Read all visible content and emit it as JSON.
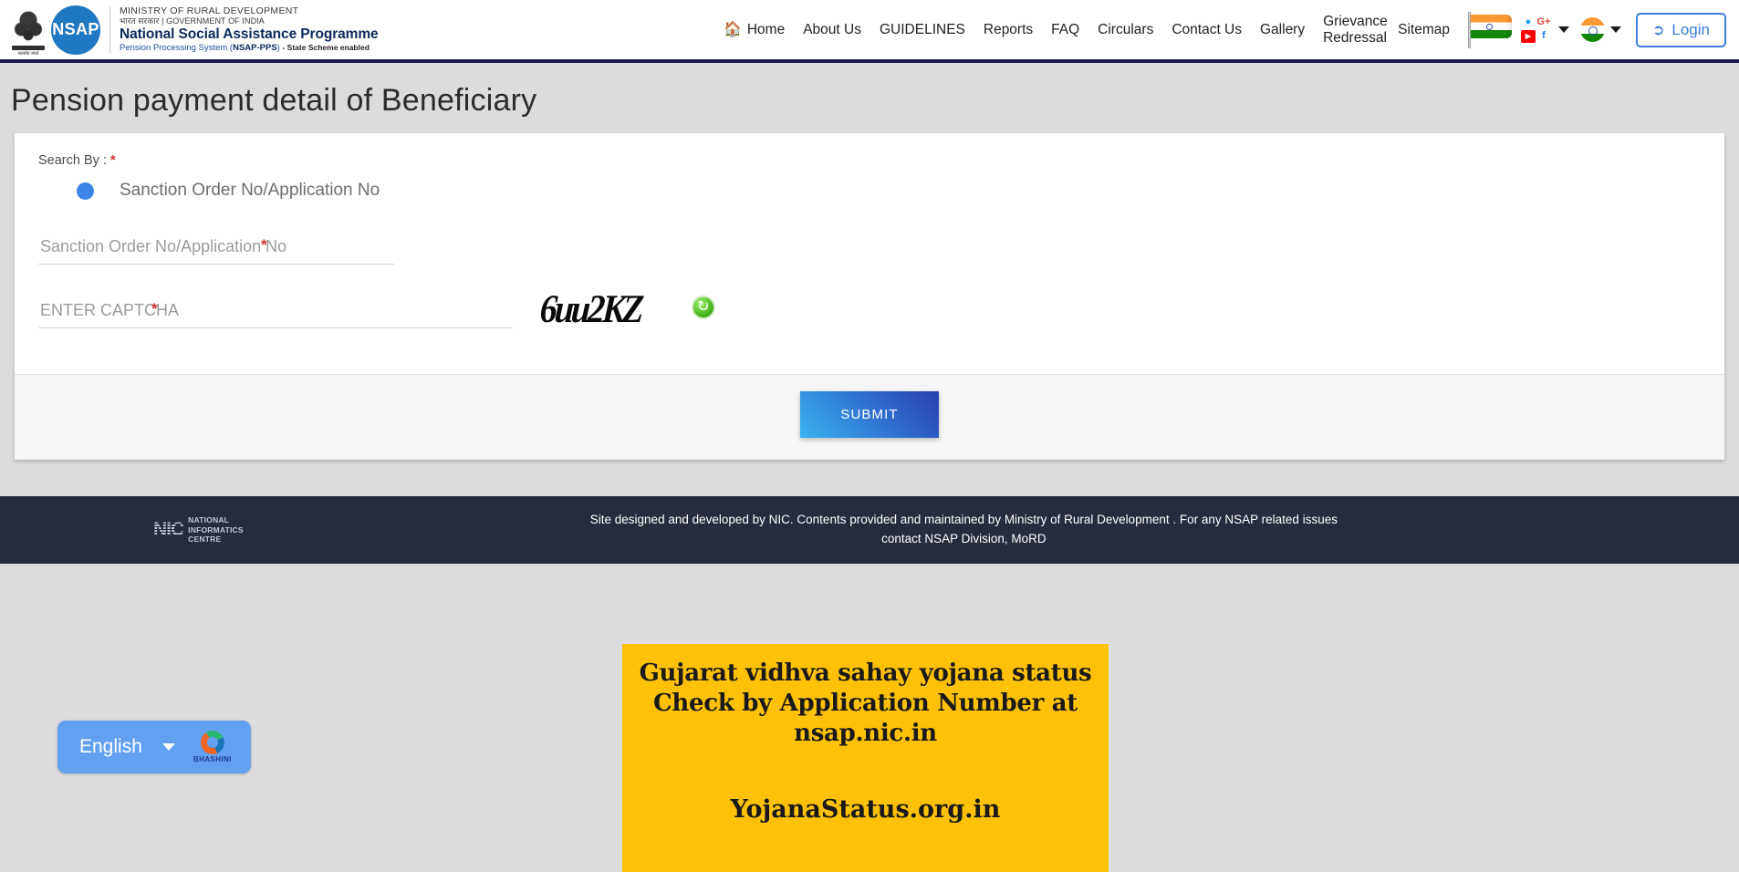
{
  "header": {
    "emblem_caption": "सत्यमेव जयते",
    "logo_badge": "NSAP",
    "ministry_line": "MINISTRY OF RURAL DEVELOPMENT",
    "govt_line_hindi": "भारत  सरकार",
    "govt_line_sep": "|",
    "govt_line_en": "GOVERNMENT OF INDIA",
    "programme_title": "National Social Assistance Programme",
    "subtitle_prefix": "Pension Processing System (",
    "subtitle_bold": "NSAP-PPS",
    "subtitle_suffix": ")",
    "subtitle_tag": "- State Scheme enabled",
    "nav": [
      {
        "label": "Home",
        "icon": "home-icon"
      },
      {
        "label": "About Us"
      },
      {
        "label": "GUIDELINES"
      },
      {
        "label": "Reports"
      },
      {
        "label": "FAQ"
      },
      {
        "label": "Circulars"
      },
      {
        "label": "Contact Us"
      },
      {
        "label": "Gallery"
      },
      {
        "label": "Grievance Redressal"
      },
      {
        "label": "Sitemap"
      }
    ],
    "social": [
      {
        "name": "twitter-icon",
        "glyph": "🐦"
      },
      {
        "name": "google-plus-icon",
        "glyph": "G+"
      },
      {
        "name": "youtube-icon",
        "glyph": "▶"
      },
      {
        "name": "facebook-icon",
        "glyph": "f"
      }
    ],
    "login_label": "Login",
    "accent_color": "#3b7ddd",
    "header_border_color": "#1a1a4e"
  },
  "page": {
    "title": "Pension payment detail of Beneficiary"
  },
  "form": {
    "search_by_label": "Search By :",
    "required_mark": "*",
    "radio_option": "Sanction Order No/Application No",
    "sanction_placeholder": "Sanction Order No/Application No",
    "captcha_placeholder": "ENTER CAPTCHA",
    "captcha_text": "6uu2KZ",
    "refresh_icon": "refresh-icon",
    "submit_label": "SUBMIT",
    "submit_gradient_from": "#3ab4f2",
    "submit_gradient_to": "#2a3fb0"
  },
  "footer": {
    "nic_mark": "NIC",
    "nic_line1": "NATIONAL",
    "nic_line2": "INFORMATICS",
    "nic_line3": "CENTRE",
    "text": "Site designed and developed by NIC. Contents provided and maintained by Ministry of Rural Development . For any NSAP related issues contact NSAP Division, MoRD",
    "background": "#262c3c"
  },
  "banner": {
    "line1": "Gujarat vidhva sahay yojana status",
    "line2": "Check by Application Number at",
    "line3": "nsap.nic.in",
    "url": "YojanaStatus.org.in",
    "background": "#ffc107"
  },
  "bhashini": {
    "language": "English",
    "brand": "BHASHINI",
    "background": "#62a0f2"
  }
}
